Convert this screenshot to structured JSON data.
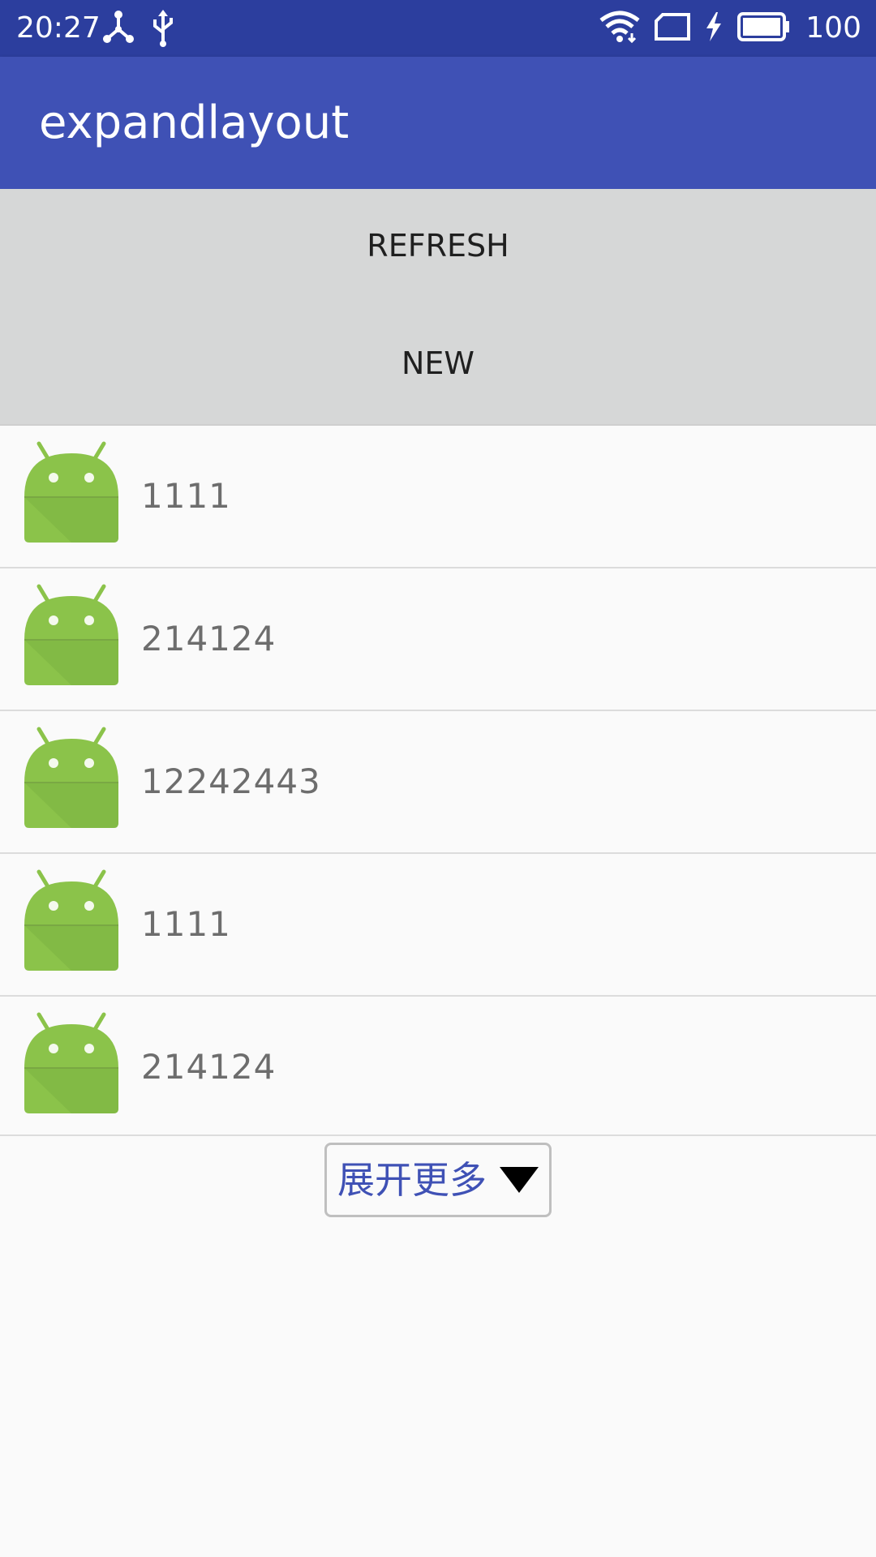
{
  "status_bar": {
    "time": "20:27",
    "battery": "100",
    "icons": [
      "hotspot-icon",
      "usb-icon",
      "wifi-icon",
      "sim-icon",
      "charging-icon",
      "battery-icon"
    ]
  },
  "app_bar": {
    "title": "expandlayout"
  },
  "buttons": {
    "refresh_label": "REFRESH",
    "new_label": "NEW"
  },
  "list": {
    "items": [
      {
        "label": "1111",
        "icon": "android-icon"
      },
      {
        "label": "214124",
        "icon": "android-icon"
      },
      {
        "label": "12242443",
        "icon": "android-icon"
      },
      {
        "label": "1111",
        "icon": "android-icon"
      },
      {
        "label": "214124",
        "icon": "android-icon"
      }
    ]
  },
  "expand": {
    "label": "展开更多",
    "icon": "triangle-down-icon"
  },
  "colors": {
    "status_bar": "#2c3e9e",
    "app_bar": "#3f51b5",
    "android_green": "#8bc34a",
    "expand_text": "#3f51b5"
  }
}
